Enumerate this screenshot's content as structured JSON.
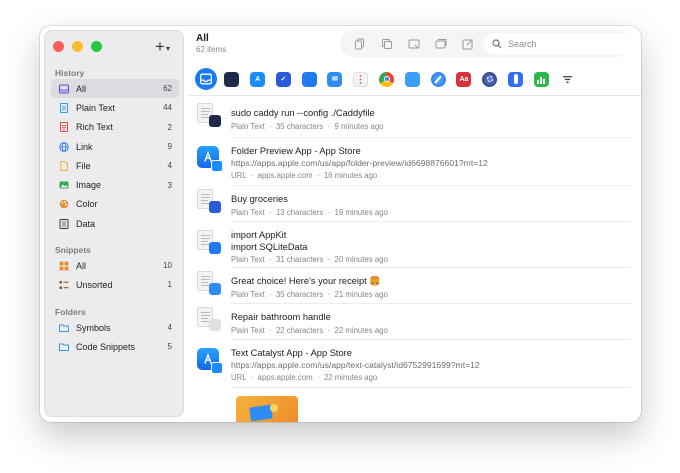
{
  "window": {
    "title": "All",
    "subtitle": "62 items"
  },
  "sidebar": {
    "sections": [
      {
        "title": "History",
        "items": [
          {
            "label": "All",
            "count": "62",
            "icon": "tray-icon",
            "color": "#5b50d6"
          },
          {
            "label": "Plain Text",
            "count": "44",
            "icon": "document-text-icon",
            "color": "#2f9bf0"
          },
          {
            "label": "Rich Text",
            "count": "2",
            "icon": "rich-text-icon",
            "color": "#e8453c"
          },
          {
            "label": "Link",
            "count": "9",
            "icon": "globe-icon",
            "color": "#2f7cf0"
          },
          {
            "label": "File",
            "count": "4",
            "icon": "file-icon",
            "color": "#f0b429"
          },
          {
            "label": "Image",
            "count": "3",
            "icon": "image-icon",
            "color": "#34a853"
          },
          {
            "label": "Color",
            "count": "",
            "icon": "palette-icon",
            "color": "#e6923a"
          },
          {
            "label": "Data",
            "count": "",
            "icon": "data-icon",
            "color": "#3a3a3c"
          }
        ]
      },
      {
        "title": "Snippets",
        "items": [
          {
            "label": "All",
            "count": "10",
            "icon": "grid-icon",
            "color": "#e6923a"
          },
          {
            "label": "Unsorted",
            "count": "1",
            "icon": "list-icon",
            "color": "#8a5a2b"
          }
        ]
      },
      {
        "title": "Folders",
        "items": [
          {
            "label": "Symbols",
            "count": "4",
            "icon": "folder-icon",
            "color": "#2f9bf0"
          },
          {
            "label": "Code Snippets",
            "count": "5",
            "icon": "folder-icon",
            "color": "#2f9bf0"
          }
        ]
      }
    ]
  },
  "toolbar": {
    "search_placeholder": "Search",
    "buttons": [
      "copy-icon",
      "duplicate-icon",
      "paste-icon",
      "stack-icon",
      "edit-icon"
    ]
  },
  "apps": [
    {
      "name": "all-apps",
      "color": "#1a7cf4",
      "glyph": ""
    },
    {
      "name": "terminal",
      "color": "#1f2a4a",
      "glyph": ""
    },
    {
      "name": "app-store",
      "color": "#1a8cff",
      "glyph": "A"
    },
    {
      "name": "reminders",
      "color": "#2a5bd7",
      "glyph": "✓"
    },
    {
      "name": "xcode",
      "color": "#1f7bef",
      "glyph": ""
    },
    {
      "name": "mail",
      "color": "#2f8cf5",
      "glyph": "✉"
    },
    {
      "name": "notes",
      "color": "#f2f2f2",
      "glyph": ""
    },
    {
      "name": "chrome",
      "color": "#e84c3d",
      "glyph": ""
    },
    {
      "name": "finder",
      "color": "#3d9df5",
      "glyph": ""
    },
    {
      "name": "safari",
      "color": "#2f8cf5",
      "glyph": ""
    },
    {
      "name": "dictionary",
      "color": "#d6343a",
      "glyph": "Aa"
    },
    {
      "name": "system",
      "color": "#1f3a8a",
      "glyph": ""
    },
    {
      "name": "instruments",
      "color": "#2f6ff0",
      "glyph": ""
    },
    {
      "name": "numbers",
      "color": "#2fb84a",
      "glyph": ""
    }
  ],
  "items": [
    {
      "lines": [
        "sudo caddy run --config ./Caddyfile"
      ],
      "type": "Plain Text",
      "detail": "35 characters",
      "time": "9 minutes ago",
      "thumb": "doc",
      "badge": "#1f2a4a"
    },
    {
      "lines": [
        "Folder Preview App - App Store",
        "https://apps.apple.com/us/app/folder-preview/id6698876601?mt=12"
      ],
      "type": "URL",
      "detail": "apps.apple.com",
      "time": "16 minutes ago",
      "thumb": "appstore",
      "badge": ""
    },
    {
      "lines": [
        "Buy groceries"
      ],
      "type": "Plain Text",
      "detail": "13 characters",
      "time": "19 minutes ago",
      "thumb": "doc",
      "badge": "#2a5bd7"
    },
    {
      "lines": [
        "import AppKit",
        "import SQLiteData"
      ],
      "type": "Plain Text",
      "detail": "31 characters",
      "time": "20 minutes ago",
      "thumb": "doc",
      "badge": "#1f7bef"
    },
    {
      "lines": [
        "Great choice! Here’s your receipt 🍔"
      ],
      "type": "Plain Text",
      "detail": "35 characters",
      "time": "21 minutes ago",
      "thumb": "doc",
      "badge": "#2f8cf5"
    },
    {
      "lines": [
        "Repair bathroom handle"
      ],
      "type": "Plain Text",
      "detail": "22 characters",
      "time": "22 minutes ago",
      "thumb": "doc",
      "badge": "#e0e0e0"
    },
    {
      "lines": [
        "Text Catalyst App - App Store",
        "https://apps.apple.com/us/app/text-catalyst/id6752991699?mt=12"
      ],
      "type": "URL",
      "detail": "apps.apple.com",
      "time": "22 minutes ago",
      "thumb": "appstore",
      "badge": ""
    }
  ],
  "meta_sep": "·"
}
